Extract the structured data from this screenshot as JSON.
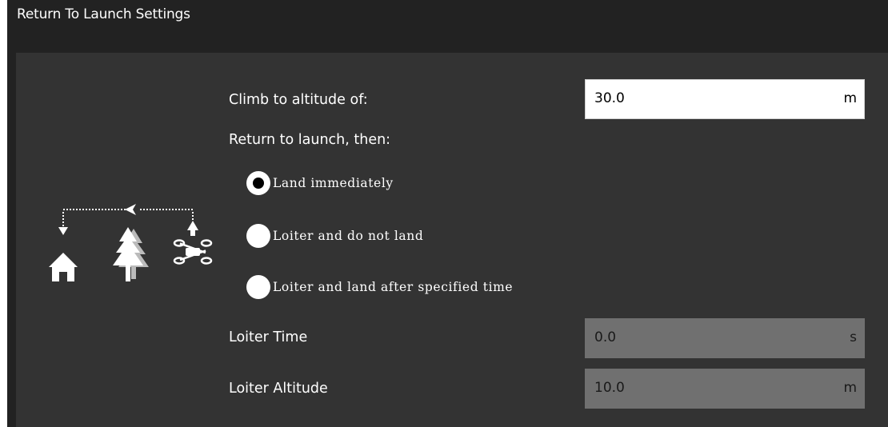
{
  "header": {
    "title": "Return To Launch Settings"
  },
  "colors": {
    "header_bg": "#222222",
    "content_bg": "#333333",
    "text": "#ffffff",
    "input_bg": "#ffffff",
    "input_disabled_bg": "#707070"
  },
  "graphic": {
    "icons": [
      "home-icon",
      "trees-icon",
      "drone-icon",
      "dotted-return-path"
    ]
  },
  "climb": {
    "label": "Climb to altitude of:",
    "value": "30.0",
    "unit": "m"
  },
  "return_then": {
    "label": "Return to launch, then:",
    "options": [
      {
        "label": "Land immediately",
        "checked": true
      },
      {
        "label": "Loiter and do not land",
        "checked": false
      },
      {
        "label": "Loiter and land after specified time",
        "checked": false
      }
    ]
  },
  "loiter_time": {
    "label": "Loiter Time",
    "value": "0.0",
    "unit": "s",
    "enabled": false
  },
  "loiter_altitude": {
    "label": "Loiter Altitude",
    "value": "10.0",
    "unit": "m",
    "enabled": false
  }
}
